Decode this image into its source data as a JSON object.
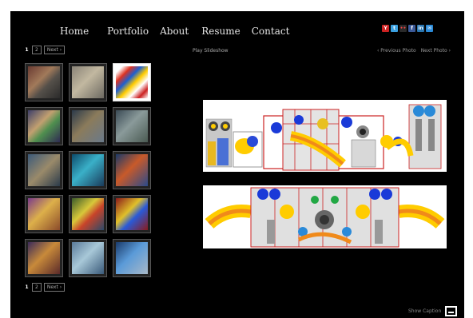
{
  "nav": {
    "items": [
      "Home",
      "Portfolio",
      "About",
      "Resume",
      "Contact"
    ]
  },
  "social": [
    {
      "icon": "youtube-icon",
      "glyph": "Y",
      "color": "#cc2222"
    },
    {
      "icon": "twitter-icon",
      "glyph": "t",
      "color": "#3aa0e0"
    },
    {
      "icon": "flickr-icon",
      "glyph": "••",
      "color": "#2a2a2a"
    },
    {
      "icon": "facebook-icon",
      "glyph": "f",
      "color": "#3b5998"
    },
    {
      "icon": "linkedin-icon",
      "glyph": "in",
      "color": "#2a76b0"
    },
    {
      "icon": "email-icon",
      "glyph": "✉",
      "color": "#2a8ad8"
    }
  ],
  "pager_top": {
    "current": "1",
    "page2": "2",
    "next": "Next ›"
  },
  "pager_bottom": {
    "current": "1",
    "page2": "2",
    "next": "Next ›"
  },
  "slideshow_label": "Play Slideshow",
  "photo_nav": {
    "prev": "‹ Previous Photo",
    "next": "Next Photo ›"
  },
  "caption_label": "Show Caption",
  "colors": {
    "background": "#000000",
    "nav_text": "#e6e6e6"
  }
}
